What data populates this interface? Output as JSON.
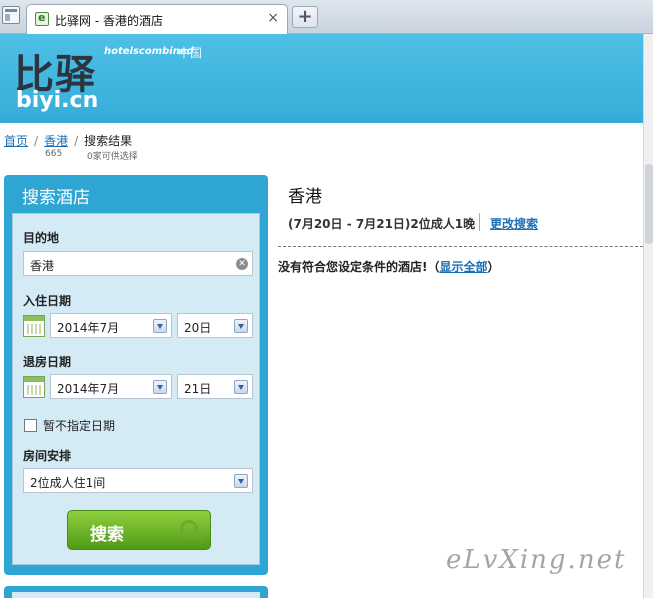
{
  "browser": {
    "tab_title": "比驿网 - 香港的酒店",
    "tab_close": "×",
    "new_tab": "+"
  },
  "header": {
    "logo_cn": "比驿",
    "logo_en": "biyi.cn",
    "partner": "hotelscombined",
    "partner_cn": "中国"
  },
  "breadcrumb": {
    "home": "首页",
    "city": "香港",
    "current": "搜索结果",
    "city_count": "665",
    "current_count": "0家可供选择"
  },
  "search_panel": {
    "title": "搜索酒店",
    "destination_label": "目的地",
    "destination_value": "香港",
    "checkin_label": "入住日期",
    "checkin_month": "2014年7月",
    "checkin_day": "20日",
    "checkout_label": "退房日期",
    "checkout_month": "2014年7月",
    "checkout_day": "21日",
    "no_date_label": "暂不指定日期",
    "room_label": "房间安排",
    "room_value": "2位成人住1间",
    "search_button": "搜索"
  },
  "results": {
    "title": "香港",
    "dates": "(7月20日 - 7月21日)2位成人1晚",
    "modify_link": "更改搜索",
    "empty_text": "没有符合您设定条件的酒店!（",
    "show_all_link": "显示全部",
    "empty_close": "）"
  },
  "watermark": "eLvXing.net"
}
